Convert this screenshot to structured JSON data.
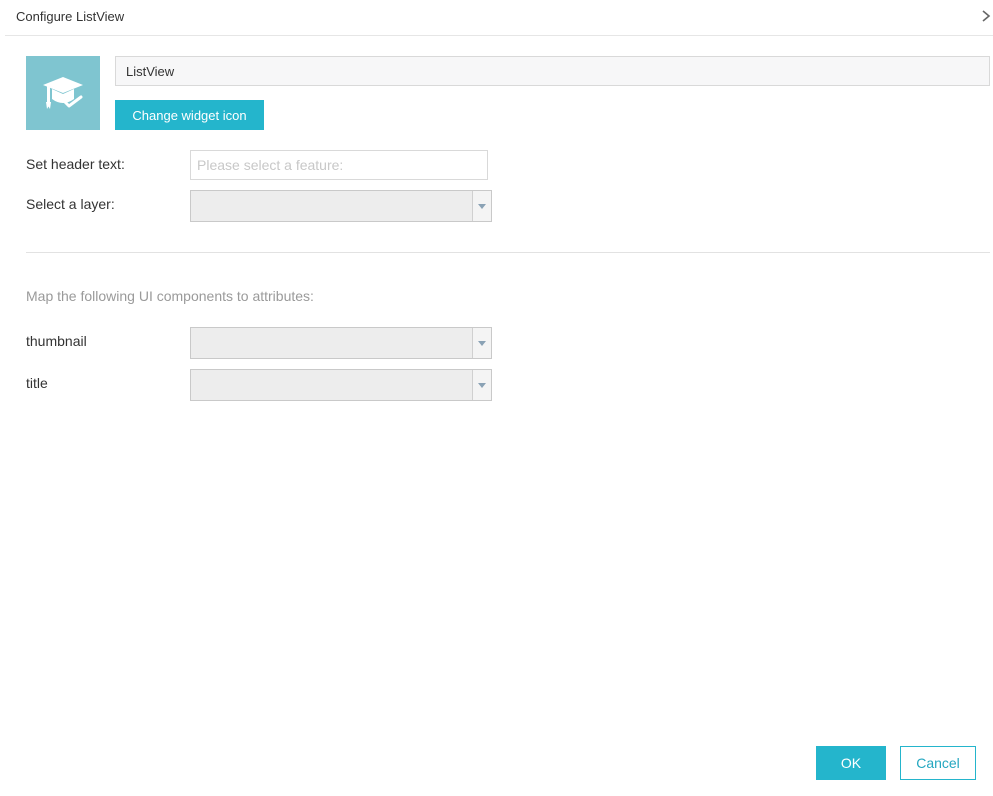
{
  "dialog": {
    "title": "Configure ListView"
  },
  "widget": {
    "name_value": "ListView",
    "icon": "graduation-cap-icon",
    "icon_bg_color": "#7fc5d0",
    "change_icon_label": "Change widget icon"
  },
  "settings": {
    "header_label": "Set header text:",
    "header_placeholder": "Please select a feature:",
    "header_value": "",
    "layer_label": "Select a layer:",
    "layer_value": ""
  },
  "mapping": {
    "heading": "Map the following UI components to attributes:",
    "rows": [
      {
        "label": "thumbnail",
        "value": ""
      },
      {
        "label": "title",
        "value": ""
      }
    ]
  },
  "footer": {
    "ok_label": "OK",
    "cancel_label": "Cancel"
  },
  "colors": {
    "accent": "#24b5cc",
    "select_bg": "#ededed"
  }
}
